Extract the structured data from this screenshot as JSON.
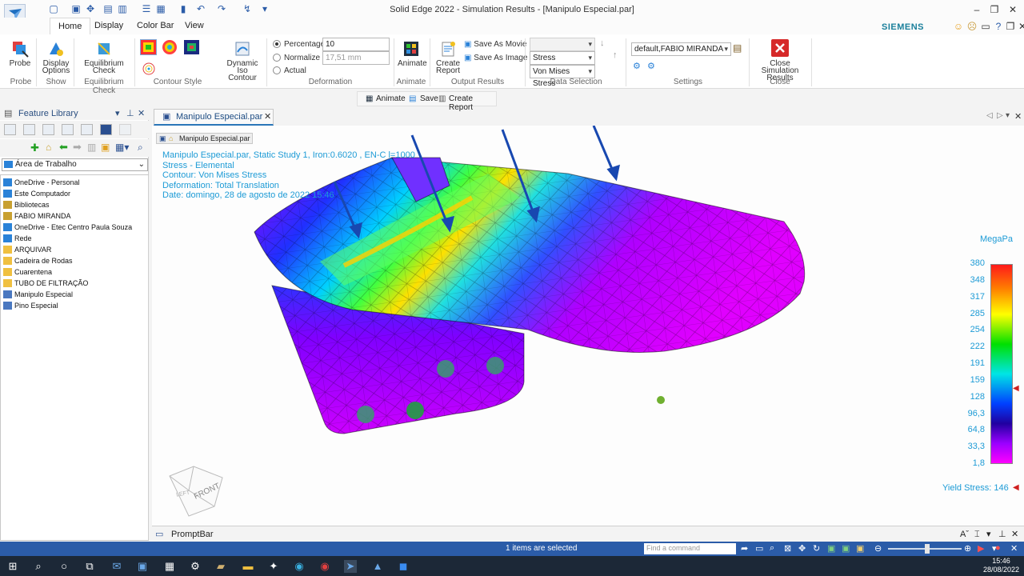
{
  "window": {
    "title": "Solid Edge 2022 - Simulation Results - [Manipulo Especial.par]",
    "brand": "SIEMENS"
  },
  "tabs": [
    "Home",
    "Display",
    "Color Bar",
    "View"
  ],
  "ribbon": {
    "probe": {
      "label": "Probe",
      "group": "Probe"
    },
    "display_options": {
      "label1": "Display",
      "label2": "Options",
      "group": "Show"
    },
    "equilibrium": {
      "label1": "Equilibrium",
      "label2": "Check",
      "group": "Equilibrium Check"
    },
    "contour_style_group": "Contour Style",
    "dynamic_iso": {
      "label1": "Dynamic Iso",
      "label2": "Contour"
    },
    "deformation": {
      "group": "Deformation",
      "percentage_label": "Percentage",
      "percentage_value": "10",
      "normalize_label": "Normalize",
      "normalize_value": "17,51 mm",
      "actual_label": "Actual"
    },
    "animate": {
      "label": "Animate",
      "group": "Animate"
    },
    "output": {
      "group": "Output Results",
      "create_report1": "Create",
      "create_report2": "Report",
      "save_movie": "Save As Movie",
      "save_image": "Save As Image"
    },
    "data_selection": {
      "group": "Data Selection",
      "dropdown1": "",
      "dropdown2": "Stress",
      "dropdown3": "Von Mises Stress"
    },
    "settings": {
      "group": "Settings",
      "value": "default,FABIO MIRANDA"
    },
    "close": {
      "label1": "Close Simulation",
      "label2": "Results",
      "group": "Close"
    }
  },
  "minibar": {
    "animate": "Animate",
    "save": "Save",
    "create_report": "Create Report"
  },
  "left_pane": {
    "title": "Feature Library",
    "folder": "Área de Trabalho",
    "items": [
      {
        "label": "OneDrive - Personal",
        "icon": "cloud-icon"
      },
      {
        "label": "Este Computador",
        "icon": "computer-icon"
      },
      {
        "label": "Bibliotecas",
        "icon": "library-icon"
      },
      {
        "label": "FABIO MIRANDA",
        "icon": "user-folder-icon"
      },
      {
        "label": "OneDrive - Etec Centro Paula Souza",
        "icon": "cloud-icon"
      },
      {
        "label": "Rede",
        "icon": "network-icon"
      },
      {
        "label": "ARQUIVAR",
        "icon": "folder-icon"
      },
      {
        "label": "Cadeira de Rodas",
        "icon": "folder-icon"
      },
      {
        "label": "Cuarentena",
        "icon": "folder-icon"
      },
      {
        "label": "TUBO DE FILTRAÇÃO",
        "icon": "folder-icon"
      },
      {
        "label": "Manipulo Especial",
        "icon": "part-icon"
      },
      {
        "label": "Pino Especial",
        "icon": "part-icon"
      }
    ]
  },
  "document": {
    "tab": "Manipulo Especial.par",
    "chip": "Manipulo Especial.par",
    "info": [
      "Manipulo Especial.par, Static Study 1, Iron:0.6020 , EN-C l=1000",
      "Stress - Elemental",
      "Contour: Von Mises Stress",
      "Deformation: Total Translation",
      "Date: domingo, 28 de agosto de 2022 15:46"
    ],
    "view_cube_label": "FRONT",
    "view_cube_side": "LEFT"
  },
  "color_bar": {
    "unit": "MegaPa",
    "labels": [
      "380",
      "348",
      "317",
      "285",
      "254",
      "222",
      "191",
      "159",
      "128",
      "96,3",
      "64,8",
      "33,3",
      "1,8"
    ],
    "yield_stress": "Yield Stress: 146"
  },
  "promptbar": "PromptBar",
  "status": {
    "text": "1 items are selected",
    "find_placeholder": "Find a command"
  },
  "taskbar": {
    "time": "15:46",
    "date": "28/08/2022"
  }
}
